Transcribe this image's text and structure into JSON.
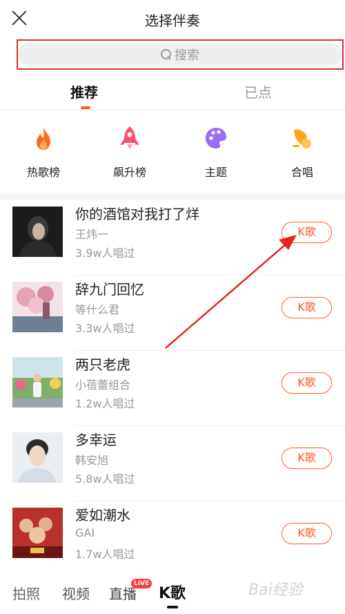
{
  "header": {
    "title": "选择伴奏"
  },
  "search": {
    "placeholder": "搜索"
  },
  "tabs": [
    {
      "label": "推荐"
    },
    {
      "label": "已点"
    }
  ],
  "categories": [
    {
      "label": "热歌榜",
      "icon": "flame-icon",
      "color": "#ff6a1a"
    },
    {
      "label": "飙升榜",
      "icon": "rocket-icon",
      "color": "#ff4d6d"
    },
    {
      "label": "主题",
      "icon": "palette-icon",
      "color": "#9b6cf5"
    },
    {
      "label": "合唱",
      "icon": "chorus-icon",
      "color": "#ffa51f"
    }
  ],
  "songs": [
    {
      "title": "你的酒馆对我打了烊",
      "artist": "王炜一",
      "count": "3.9w人唱过",
      "action": "K歌"
    },
    {
      "title": "辞九门回忆",
      "artist": "等什么君",
      "count": "3.3w人唱过",
      "action": "K歌"
    },
    {
      "title": "两只老虎",
      "artist": "小蓓蕾组合",
      "count": "1.2w人唱过",
      "action": "K歌"
    },
    {
      "title": "多幸运",
      "artist": "韩安旭",
      "count": "5.8w人唱过",
      "action": "K歌"
    },
    {
      "title": "爱如潮水",
      "artist": "GAI",
      "count": "1.7w人唱过",
      "action": "K歌"
    }
  ],
  "bottom_nav": {
    "photo": "拍照",
    "video": "视频",
    "live": "直播",
    "live_badge": "LIVE",
    "karaoke": "K歌"
  },
  "watermark": "Bai经验",
  "colors": {
    "accent": "#ff5a1f",
    "highlight_box": "#d9302a"
  }
}
